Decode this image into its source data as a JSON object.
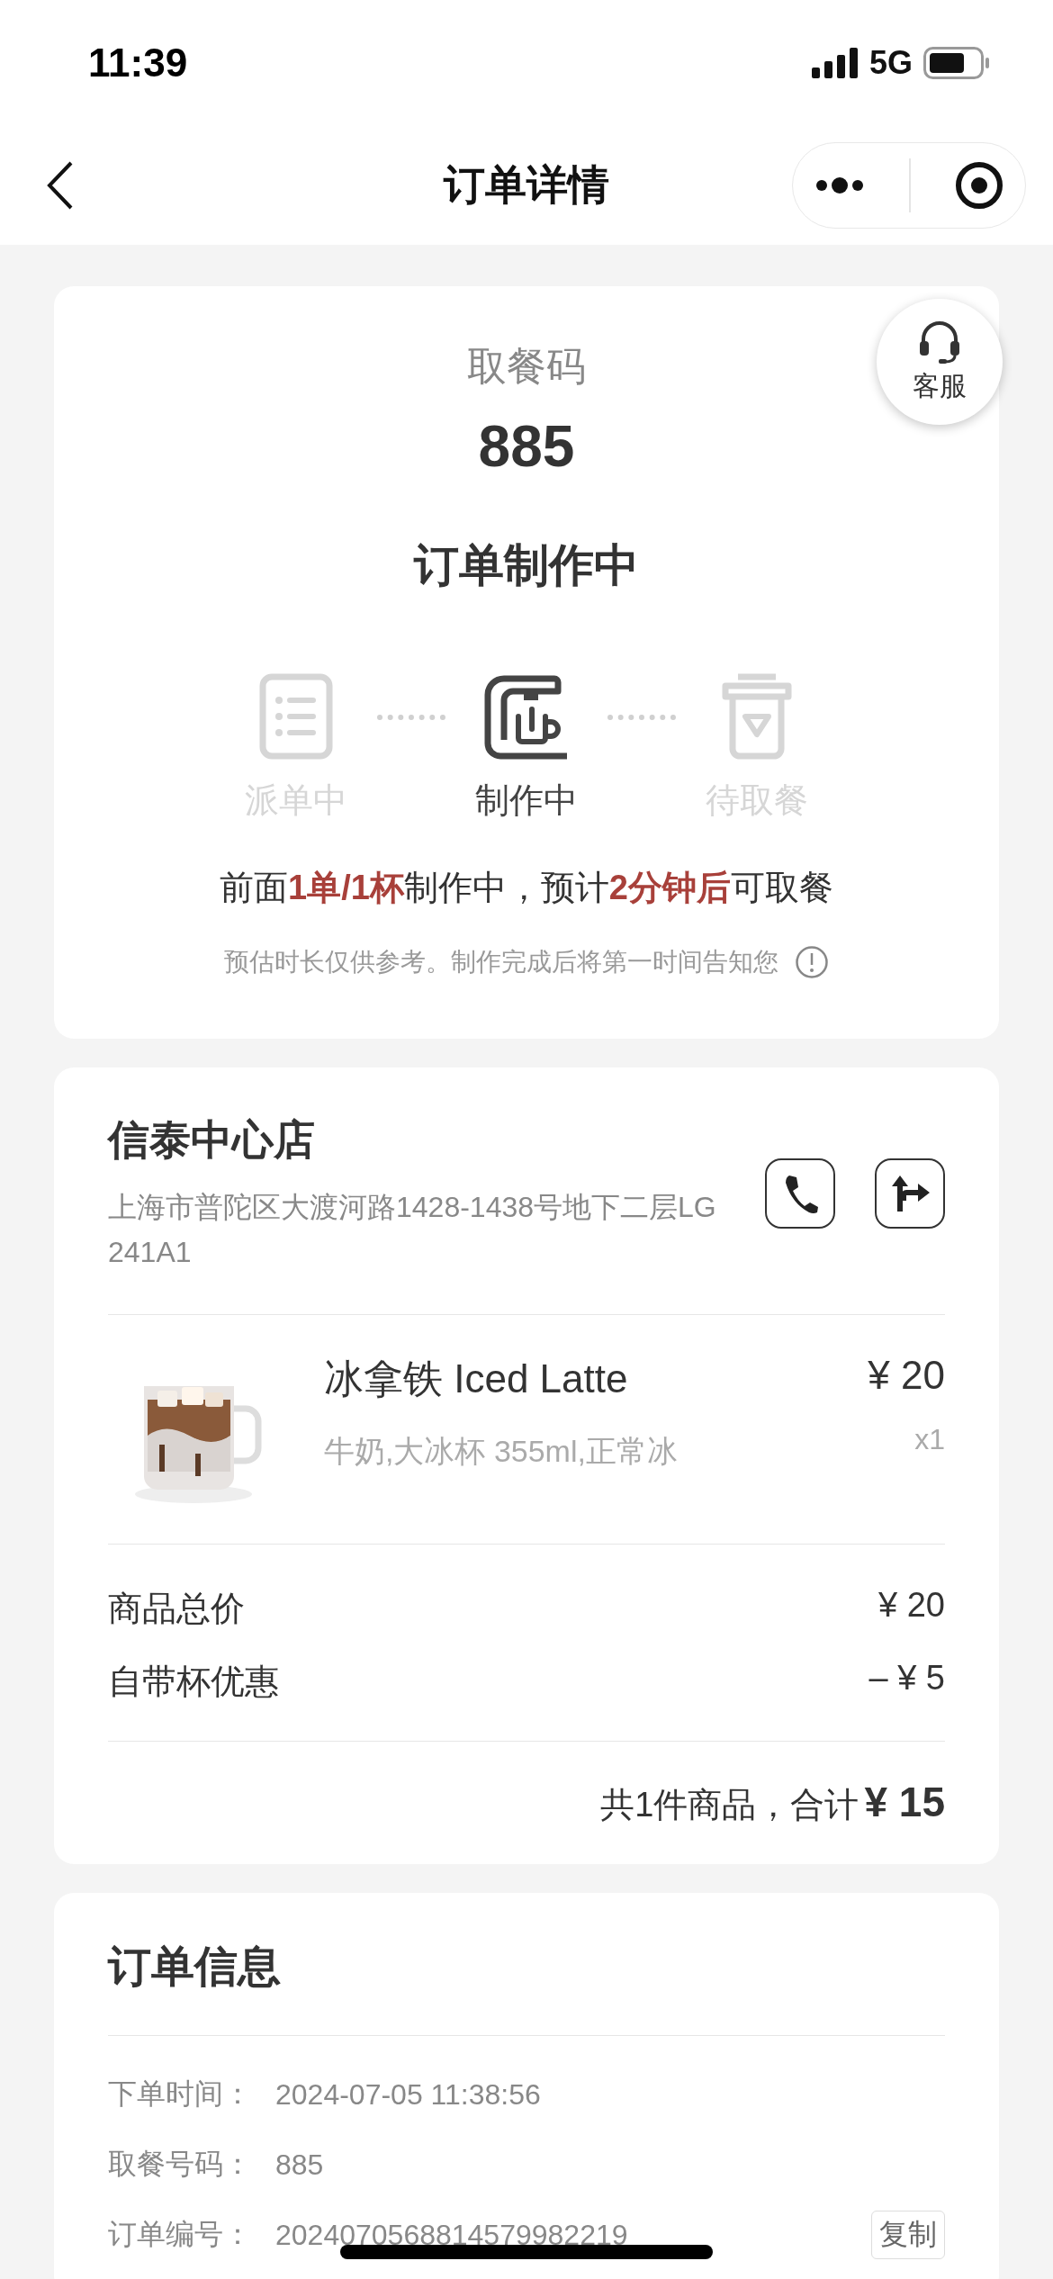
{
  "status_bar": {
    "time": "11:39",
    "network": "5G"
  },
  "nav": {
    "title": "订单详情"
  },
  "pickup": {
    "label": "取餐码",
    "code": "885",
    "status": "订单制作中",
    "service": "客服",
    "steps": [
      {
        "kind": "order",
        "label": "派单中",
        "selected": false
      },
      {
        "kind": "machine",
        "label": "制作中",
        "selected": true
      },
      {
        "kind": "cup",
        "label": "待取餐",
        "selected": false
      }
    ],
    "message": "前面**1单/1杯**制作中，预计**2分钟后**可取餐",
    "note": "预估时长仅供参考。制作完成后将第一时间告知您"
  },
  "store": {
    "name": "信泰中心店",
    "address": "上海市普陀区大渡河路1428-1438号地下二层LG241A1",
    "item": {
      "name": "冰拿铁 Iced Latte",
      "options": "牛奶,大冰杯 355ml,正常冰",
      "price": "¥ 20",
      "quantity": "x1"
    },
    "charges": [
      {
        "label": "商品总价",
        "amount": "¥ 20"
      },
      {
        "label": "自带杯优惠",
        "amount": "– ¥ 5"
      }
    ],
    "total": {
      "label": "共1件商品，合计",
      "amount": "¥ 15"
    }
  },
  "order_info": {
    "title": "订单信息",
    "rows": [
      {
        "label": "下单时间：",
        "value": "2024-07-05 11:38:56"
      },
      {
        "label": "取餐号码：",
        "value": "885"
      },
      {
        "label": "订单编号：",
        "value": "2024070568814579982219",
        "action": "复制"
      }
    ]
  }
}
